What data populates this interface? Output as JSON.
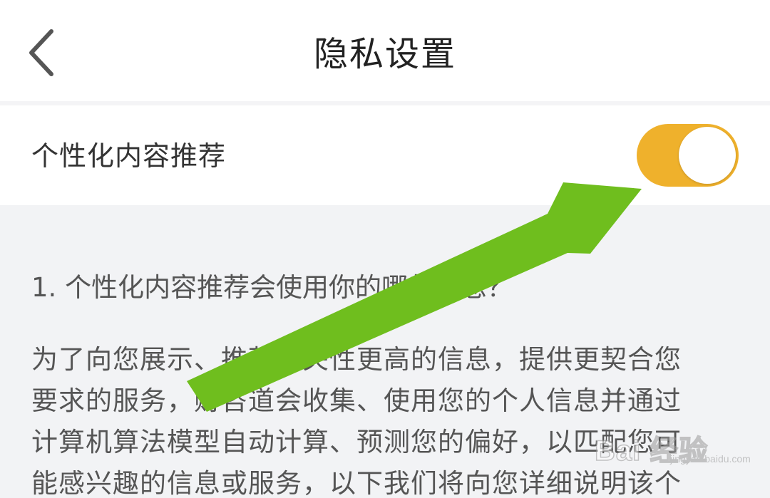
{
  "header": {
    "title": "隐私设置",
    "back_icon": "chevron-left-icon"
  },
  "setting": {
    "label": "个性化内容推荐",
    "toggle_state": "on",
    "toggle_color": "#efb12c"
  },
  "content": {
    "question": "1. 个性化内容推荐会使用你的哪些信息？",
    "paragraph_lines": [
      "为了向您展示、推荐相关性更高的信息，提供更契合您",
      "要求的服务，财咨道会收集、使用您的个人信息并通过",
      "计算机算法模型自动计算、预测您的偏好，以匹配您可",
      "能感兴趣的信息或服务，以下我们将向您详细说明该个"
    ]
  },
  "overlay": {
    "arrow_color": "#6fbe1e",
    "arrow_icon": "arrow-icon"
  },
  "watermark": {
    "text": "Bai 经验",
    "subtext": "jingyan.baidu.com"
  }
}
